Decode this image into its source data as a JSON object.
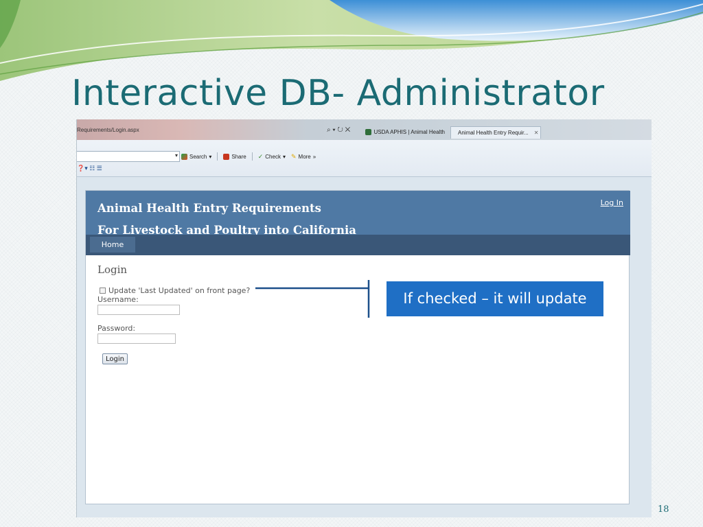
{
  "slide": {
    "title": "Interactive DB- Administrator",
    "number": "18"
  },
  "browser": {
    "address_fragment": "Requirements/Login.aspx",
    "address_controls": "⌕ ▾ ↻ ✕",
    "tabs": [
      {
        "label": "USDA APHIS | Animal Health",
        "active": false,
        "icon": "shield-icon"
      },
      {
        "label": "Animal Health Entry Requir...",
        "active": true,
        "icon": "globe-icon"
      }
    ],
    "tab_close": "✕",
    "toolbar": {
      "combo_arrow": "▾",
      "search_label": "Search",
      "search_arrow": "▾",
      "share_label": "Share",
      "check_label": "Check",
      "check_arrow": "▾",
      "more_label": "More",
      "more_chevrons": "»"
    },
    "row2_icons": "❓▾ ☷ ☰"
  },
  "site": {
    "title_line1": "Animal Health Entry Requirements",
    "title_line2": "For Livestock and Poultry into California",
    "login_link": "Log In",
    "nav_home": "Home",
    "login_heading": "Login",
    "checkbox_label": "Update 'Last Updated' on front page?",
    "username_label": "Username:",
    "username_value": "",
    "password_label": "Password:",
    "password_value": "",
    "login_button": "Login"
  },
  "callout": {
    "text": "If checked – it will update"
  },
  "colors": {
    "title": "#1b6b74",
    "site_header": "#4f79a4",
    "site_nav": "#3a5778",
    "callout_bg": "#1f6fc5",
    "callout_line": "#1c4f8a"
  }
}
